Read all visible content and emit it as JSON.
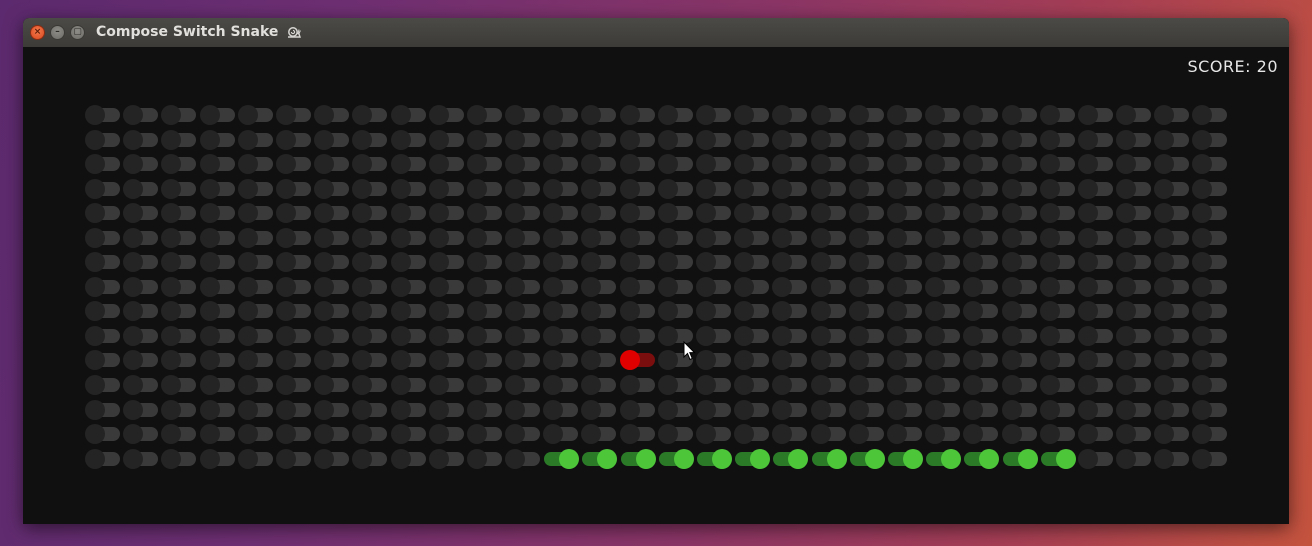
{
  "window": {
    "title": "Compose Switch Snake",
    "title_icon": "snail-emoji",
    "controls": [
      "close-icon",
      "minimize-icon",
      "maximize-icon"
    ]
  },
  "game": {
    "score_text": "SCORE: 20",
    "grid": {
      "columns": 30,
      "rows": 15
    },
    "snake": [
      [
        12,
        14
      ],
      [
        13,
        14
      ],
      [
        14,
        14
      ],
      [
        15,
        14
      ],
      [
        16,
        14
      ],
      [
        17,
        14
      ],
      [
        18,
        14
      ],
      [
        19,
        14
      ],
      [
        20,
        14
      ],
      [
        21,
        14
      ],
      [
        22,
        14
      ],
      [
        23,
        14
      ],
      [
        24,
        14
      ],
      [
        25,
        14
      ]
    ],
    "food": [
      14,
      10
    ],
    "colors": {
      "off_thumb": "#242424",
      "off_track": "#3a3a3a",
      "snake_thumb": "#4ec63a",
      "snake_track": "#2a7a28",
      "food_thumb": "#e00000",
      "food_track": "#7a0e0e",
      "background": "#101010"
    }
  }
}
